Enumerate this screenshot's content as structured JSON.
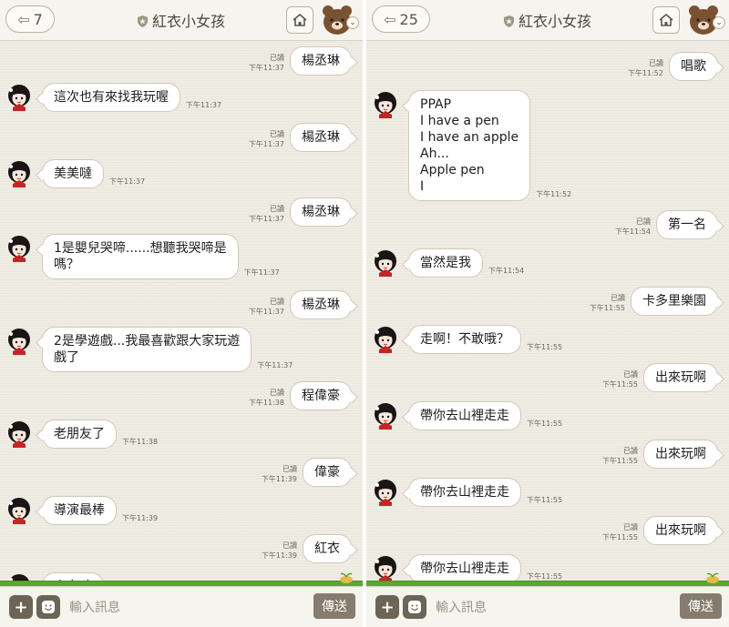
{
  "left": {
    "back_count": "7",
    "title": "紅衣小女孩",
    "messages": [
      {
        "type": "out",
        "text": "楊丞琳",
        "read": "已讀",
        "time": "下午11:37"
      },
      {
        "type": "in",
        "text": "這次也有來找我玩喔",
        "time": "下午11:37"
      },
      {
        "type": "out",
        "text": "楊丞琳",
        "read": "已讀",
        "time": "下午11:37"
      },
      {
        "type": "in",
        "text": "美美噠",
        "time": "下午11:37"
      },
      {
        "type": "out",
        "text": "楊丞琳",
        "read": "已讀",
        "time": "下午11:37"
      },
      {
        "type": "in",
        "text": "1是嬰兒哭啼......想聽我哭啼是\n嗎？",
        "time": "下午11:37"
      },
      {
        "type": "out",
        "text": "楊丞琳",
        "read": "已讀",
        "time": "下午11:37"
      },
      {
        "type": "in",
        "text": "2是學遊戲...我最喜歡跟大家玩遊\n戲了",
        "time": "下午11:37"
      },
      {
        "type": "out",
        "text": "程偉豪",
        "read": "已讀",
        "time": "下午11:38"
      },
      {
        "type": "in",
        "text": "老朋友了",
        "time": "下午11:38"
      },
      {
        "type": "out",
        "text": "偉豪",
        "read": "已讀",
        "time": "下午11:39"
      },
      {
        "type": "in",
        "text": "導演最棒",
        "time": "下午11:39"
      },
      {
        "type": "out",
        "text": "紅衣",
        "read": "已讀",
        "time": "下午11:39"
      },
      {
        "type": "in",
        "text": "小女孩",
        "time": ""
      }
    ]
  },
  "right": {
    "back_count": "25",
    "title": "紅衣小女孩",
    "messages": [
      {
        "type": "out",
        "text": "唱歌",
        "read": "已讀",
        "time": "下午11:52"
      },
      {
        "type": "in",
        "text": "PPAP\nI have a pen\nI have an apple\nAh...\nApple pen\nI",
        "time": "下午11:52"
      },
      {
        "type": "out",
        "text": "第一名",
        "read": "已讀",
        "time": "下午11:54"
      },
      {
        "type": "in",
        "text": "當然是我",
        "time": "下午11:54"
      },
      {
        "type": "out",
        "text": "卡多里樂園",
        "read": "已讀",
        "time": "下午11:55"
      },
      {
        "type": "in",
        "text": "走啊！不敢哦？",
        "time": "下午11:55"
      },
      {
        "type": "out",
        "text": "出來玩啊",
        "read": "已讀",
        "time": "下午11:55"
      },
      {
        "type": "in",
        "text": "帶你去山裡走走",
        "time": "下午11:55"
      },
      {
        "type": "out",
        "text": "出來玩啊",
        "read": "已讀",
        "time": "下午11:55"
      },
      {
        "type": "in",
        "text": "帶你去山裡走走",
        "time": "下午11:55"
      },
      {
        "type": "out",
        "text": "出來玩啊",
        "read": "已讀",
        "time": "下午11:55"
      },
      {
        "type": "in",
        "text": "帶你去山裡走走",
        "time": "下午11:55"
      }
    ]
  },
  "input": {
    "placeholder": "輸入訊息",
    "send_label": "傳送"
  },
  "icons": {
    "back": "back-arrow-icon",
    "shield": "shield-icon",
    "home": "home-icon",
    "avatar": "bear-avatar-icon",
    "chevron": "chevron-down-icon",
    "plus": "plus-icon",
    "sticker": "emoji-icon",
    "contact_avatar": "girl-avatar-icon"
  },
  "colors": {
    "background": "#efece3",
    "bubble": "#ffffff",
    "send_button": "#857c6d",
    "grass": "#5aa832"
  }
}
